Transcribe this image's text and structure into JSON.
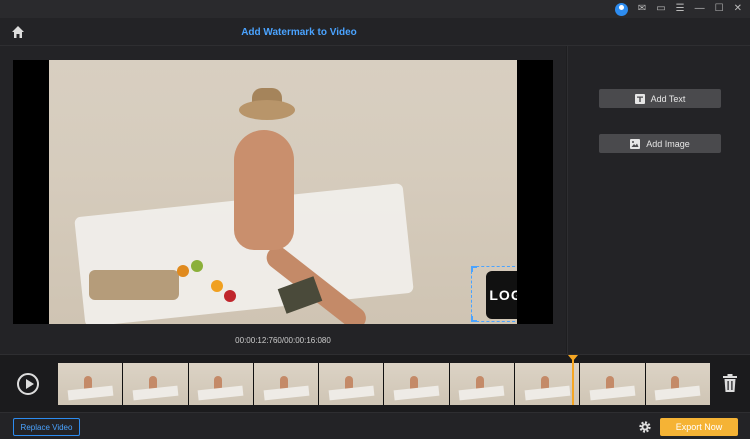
{
  "header": {
    "title": "Add Watermark to Video"
  },
  "player": {
    "timecode": "00:00:12:760/00:00:16:080",
    "watermark_text": "LOGO"
  },
  "right_panel": {
    "add_text_label": "Add Text",
    "add_image_label": "Add Image"
  },
  "footer": {
    "replace_label": "Replace Video",
    "export_label": "Export Now"
  },
  "colors": {
    "accent": "#2d8cf0",
    "export": "#f5b335",
    "playhead": "#f5a623"
  },
  "icons": [
    "user-icon",
    "mail-icon",
    "feedback-icon",
    "menu-icon",
    "minimize-icon",
    "maximize-icon",
    "close-icon",
    "home-icon",
    "text-icon",
    "image-icon",
    "play-icon",
    "trash-icon",
    "gear-icon"
  ]
}
